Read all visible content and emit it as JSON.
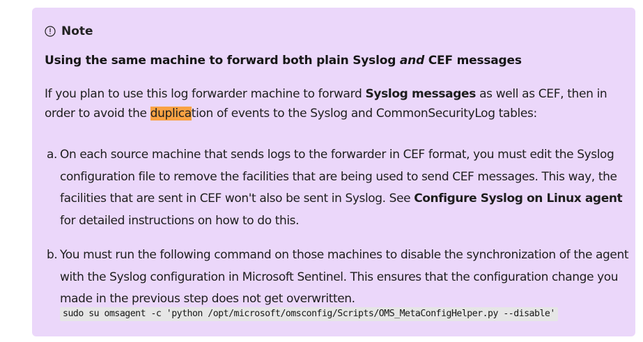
{
  "note": {
    "label": "Note",
    "heading_part1": "Using the same machine to forward both plain Syslog ",
    "heading_em": "and",
    "heading_part2": " CEF messages",
    "paragraph": {
      "part1": "If you plan to use this log forwarder machine to forward ",
      "bold": "Syslog messages",
      "part2": " as well as CEF, then in order to avoid the ",
      "highlight": "duplica",
      "part3": "tion of events to the Syslog and CommonSecurityLog tables:"
    },
    "items": [
      {
        "marker": "a.",
        "text_part1": "On each source machine that sends logs to the forwarder in CEF format, you must edit the Syslog configuration file to remove the facilities that are being used to send CEF messages. This way, the facilities that are sent in CEF won't also be sent in Syslog. See ",
        "link": "Configure Syslog on Linux agent",
        "text_part2": " for detailed instructions on how to do this."
      },
      {
        "marker": "b.",
        "text": "You must run the following command on those machines to disable the synchronization of the agent with the Syslog configuration in Microsoft Sentinel. This ensures that the configuration change you made in the previous step does not get overwritten."
      }
    ],
    "code": "sudo su omsagent -c 'python /opt/microsoft/omsconfig/Scripts/OMS_MetaConfigHelper.py --disable'"
  },
  "colors": {
    "note_background": "#ebd7fa",
    "highlight": "#f9a243",
    "code_background": "#e6e6e6"
  }
}
